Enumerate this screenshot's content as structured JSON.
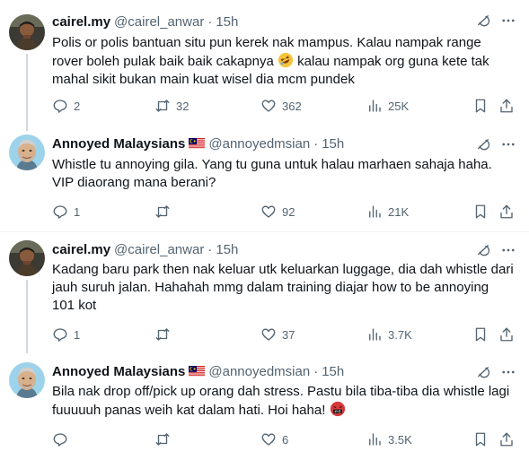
{
  "tweets": [
    {
      "name": "cairel.my",
      "handle": "@cairel_anwar",
      "dot": "·",
      "time": "15h",
      "flag": false,
      "avatar": "man-avatar",
      "text_before_emoji": "Polis or polis bantuan situ pun kerek nak mampus. Kalau nampak range rover boleh pulak baik baik cakapnya ",
      "emoji": "rolling-laughing-emoji",
      "text_after_emoji": " kalau nampak org guna kete tak mahal sikit bukan main kuat wisel dia mcm pundek",
      "replies": "2",
      "reposts": "32",
      "likes": "362",
      "views": "25K"
    },
    {
      "name": "Annoyed Malaysians",
      "handle": "@annoyedmsian",
      "dot": "·",
      "time": "15h",
      "flag": true,
      "avatar": "old-man-avatar",
      "text": "Whistle tu annoying gila. Yang tu guna untuk halau marhaen sahaja haha. VIP diaorang mana berani?",
      "replies": "1",
      "reposts": "",
      "likes": "92",
      "views": "21K"
    },
    {
      "name": "cairel.my",
      "handle": "@cairel_anwar",
      "dot": "·",
      "time": "15h",
      "flag": false,
      "avatar": "man-avatar",
      "text": "Kadang baru park then nak keluar utk keluarkan luggage, dia dah whistle dari jauh suruh jalan. Hahahah mmg dalam training diajar how to be annoying 101 kot",
      "replies": "1",
      "reposts": "",
      "likes": "37",
      "views": "3.7K"
    },
    {
      "name": "Annoyed Malaysians",
      "handle": "@annoyedmsian",
      "dot": "·",
      "time": "15h",
      "flag": true,
      "avatar": "old-man-avatar",
      "text_before_emoji": "Bila nak drop off/pick up orang dah stress. Pastu bila tiba-tiba dia whistle lagi fuuuuuh panas weih kat dalam hati. Hoi haha! ",
      "emoji": "angry-cursing-emoji",
      "text_after_emoji": "",
      "replies": "",
      "reposts": "",
      "likes": "6",
      "views": "3.5K"
    }
  ],
  "colors": {
    "text": "#0f1419",
    "muted": "#536471",
    "thread_line": "#cfd9de",
    "divider": "#eff3f4"
  }
}
